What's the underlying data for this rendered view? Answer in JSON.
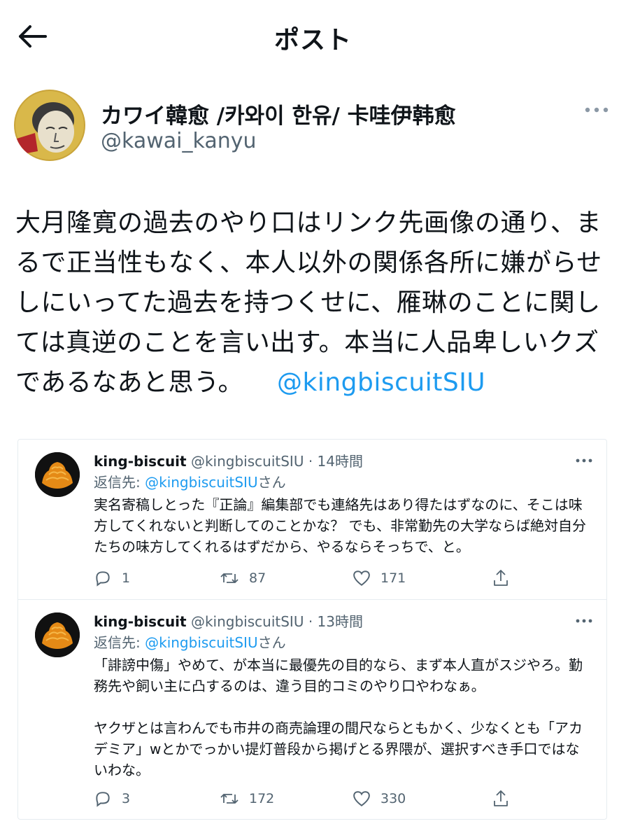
{
  "header": {
    "title": "ポスト"
  },
  "tweet": {
    "author_name": "カワイ韓愈 /카와이 한유/ 卡哇伊韩愈",
    "author_handle": "@kawai_kanyu",
    "text": "大月隆寛の過去のやり口はリンク先画像の通り、まるで正当性もなく、本人以外の関係各所に嫌がらせしにいってた過去を持つくせに、雁琳のことに関しては真逆のことを言い出す。本当に人品卑しいクズであるなあと思う。",
    "mention": "@kingbiscuitSIU"
  },
  "replies": [
    {
      "name": "king-biscuit",
      "handle": "@kingbiscuitSIU",
      "time": "14時間",
      "reply_prefix": "返信先: ",
      "reply_to": "@kingbiscuitSIU",
      "reply_suffix": "さん",
      "text": "実名寄稿しとった『正論』編集部でも連絡先はあり得たはずなのに、そこは味方してくれないと判断してのことかな？ でも、非常勤先の大学ならば絶対自分たちの味方してくれるはずだから、やるならそっちで、と。",
      "replies": "1",
      "retweets": "87",
      "likes": "171"
    },
    {
      "name": "king-biscuit",
      "handle": "@kingbiscuitSIU",
      "time": "13時間",
      "reply_prefix": "返信先: ",
      "reply_to": "@kingbiscuitSIU",
      "reply_suffix": "さん",
      "text": "「誹謗中傷」やめて、が本当に最優先の目的なら、まず本人直がスジやろ。勤務先や飼い主に凸するのは、違う目的コミのやり口やわなぁ。\n\nヤクザとは言わんでも市井の商売論理の間尺ならともかく、少なくとも「アカデミア」wとかでっかい提灯普段から掲げとる界隈が、選択すべき手口ではないわな。",
      "replies": "3",
      "retweets": "172",
      "likes": "330"
    }
  ],
  "icons": {
    "back": "back-arrow-icon",
    "more": "more-dots-icon",
    "reply": "reply-icon",
    "retweet": "retweet-icon",
    "like": "heart-icon",
    "share": "share-icon"
  },
  "colors": {
    "link": "#1d9bf0",
    "secondary": "#536471",
    "text": "#0f1419"
  }
}
